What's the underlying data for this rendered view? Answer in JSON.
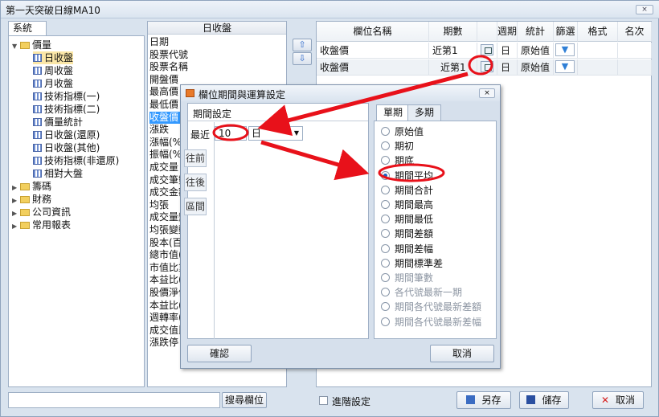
{
  "window": {
    "title": "第一天突破日線MA10",
    "close": "×"
  },
  "left": {
    "tab": "系統",
    "tree": [
      {
        "label": "價量",
        "type": "folder-open"
      },
      {
        "label": "日收盤",
        "type": "grid",
        "selected": true
      },
      {
        "label": "周收盤",
        "type": "grid"
      },
      {
        "label": "月收盤",
        "type": "grid"
      },
      {
        "label": "技術指標(一)",
        "type": "grid"
      },
      {
        "label": "技術指標(二)",
        "type": "grid"
      },
      {
        "label": "價量統計",
        "type": "grid"
      },
      {
        "label": "日收盤(還原)",
        "type": "grid"
      },
      {
        "label": "日收盤(其他)",
        "type": "grid"
      },
      {
        "label": "技術指標(非還原)",
        "type": "grid"
      },
      {
        "label": "相對大盤",
        "type": "grid"
      },
      {
        "label": "籌碼",
        "type": "folder"
      },
      {
        "label": "財務",
        "type": "folder"
      },
      {
        "label": "公司資訊",
        "type": "folder"
      },
      {
        "label": "常用報表",
        "type": "folder"
      }
    ]
  },
  "fields": {
    "header": "日收盤",
    "items": [
      "日期",
      "股票代號",
      "股票名稱",
      "開盤價",
      "最高價",
      "最低價",
      "收盤價",
      "漲跌",
      "漲幅(%)",
      "振幅(%)",
      "成交量",
      "成交筆數",
      "成交金額",
      "均張",
      "成交量變動",
      "均張變動",
      "股本(百",
      "總市值(",
      "市值比重",
      "本益比(",
      "股價淨值",
      "本益比(",
      "週轉率(",
      "成交值比",
      "漲跌停"
    ],
    "selected_index": 6
  },
  "move_buttons": {
    "up": "⇧",
    "down": "⇩"
  },
  "grid": {
    "headers": [
      "欄位名稱",
      "期數",
      "",
      "週期",
      "統計",
      "篩選",
      "格式",
      "名次"
    ],
    "rows": [
      {
        "name": "收盤價",
        "period": "近第1",
        "cycle": "日",
        "stat": "原始值"
      },
      {
        "name": "收盤價",
        "period": "近第1",
        "cycle": "日",
        "stat": "原始值"
      }
    ],
    "filter_icon": "▼"
  },
  "bottom": {
    "search_value": "",
    "search_button": "搜尋欄位",
    "advanced": "進階設定",
    "save_as": "另存",
    "save": "儲存",
    "cancel": "取消"
  },
  "dialog": {
    "title": "欄位期間與運算設定",
    "close": "×",
    "period_label": "期間設定",
    "recent_label": "最近",
    "recent_value": "10",
    "unit": "日",
    "unit_arrow": "▼",
    "side_buttons": [
      "往前",
      "往後",
      "區間"
    ],
    "tabs": [
      "單期",
      "多期"
    ],
    "options": [
      {
        "label": "原始值",
        "checked": false,
        "disabled": false
      },
      {
        "label": "期初",
        "checked": false,
        "disabled": false
      },
      {
        "label": "期底",
        "checked": false,
        "disabled": false
      },
      {
        "label": "期間平均",
        "checked": true,
        "disabled": false
      },
      {
        "label": "期間合計",
        "checked": false,
        "disabled": false
      },
      {
        "label": "期間最高",
        "checked": false,
        "disabled": false
      },
      {
        "label": "期間最低",
        "checked": false,
        "disabled": false
      },
      {
        "label": "期間差額",
        "checked": false,
        "disabled": false
      },
      {
        "label": "期間差幅",
        "checked": false,
        "disabled": false
      },
      {
        "label": "期間標準差",
        "checked": false,
        "disabled": false
      },
      {
        "label": "期間筆數",
        "checked": false,
        "disabled": true
      },
      {
        "label": "各代號最新一期",
        "checked": false,
        "disabled": true
      },
      {
        "label": "期間各代號最新差額",
        "checked": false,
        "disabled": true
      },
      {
        "label": "期間各代號最新差幅",
        "checked": false,
        "disabled": true
      }
    ],
    "ok": "確認",
    "cancel": "取消"
  },
  "colors": {
    "selection": "#3399ff",
    "tree_selection": "#fbe7a8",
    "annotation": "#e8111a"
  }
}
